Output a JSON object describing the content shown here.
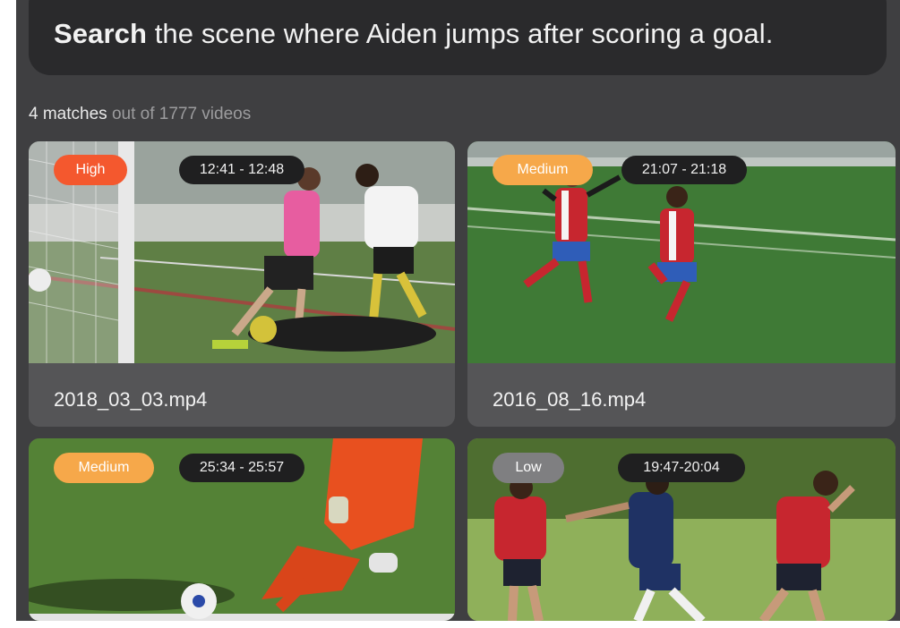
{
  "search": {
    "keyword": "Search",
    "query_text": "the scene where Aiden jumps after scoring a goal."
  },
  "results": {
    "match_count": "4 matches",
    "out_of": "out of 1777 videos"
  },
  "videos": [
    {
      "confidence": "High",
      "confidence_color": "#f4582e",
      "timestamp": "12:41 - 12:48",
      "filename": "2018_03_03.mp4"
    },
    {
      "confidence": "Medium",
      "confidence_color": "#f6a84a",
      "timestamp": "21:07 - 21:18",
      "filename": "2016_08_16.mp4"
    },
    {
      "confidence": "Medium",
      "confidence_color": "#f6a84a",
      "timestamp": "25:34 - 25:57",
      "filename": ""
    },
    {
      "confidence": "Low",
      "confidence_color": "#7f7f81",
      "timestamp": "19:47-20:04",
      "filename": ""
    }
  ]
}
